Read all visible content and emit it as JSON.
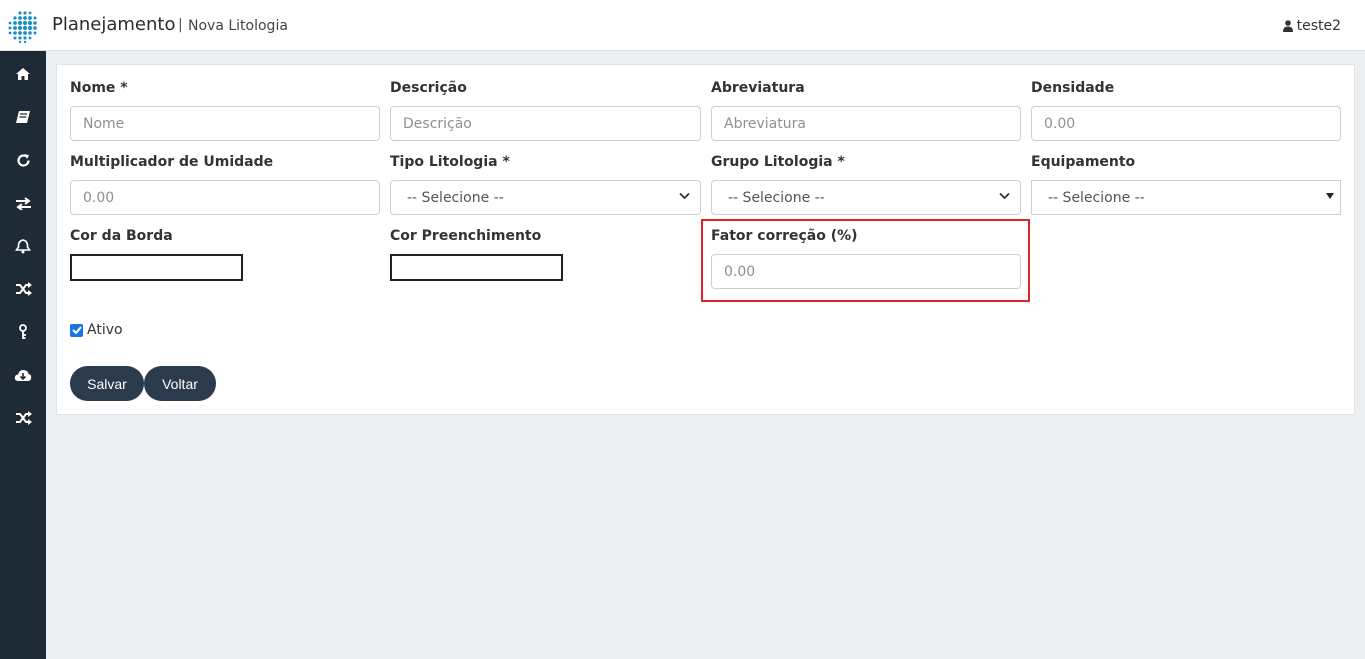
{
  "header": {
    "app_title": "Planejamento",
    "separator": "|",
    "page_title": "Nova Litologia",
    "user_name": "teste2"
  },
  "sidebar": {
    "icons": [
      "home-icon",
      "book-icon",
      "refresh-icon",
      "exchange-icon",
      "bell-icon",
      "shuffle-icon",
      "key-icon",
      "cloud-download-icon",
      "shuffle-icon"
    ]
  },
  "form": {
    "nome_label": "Nome *",
    "nome_placeholder": "Nome",
    "descricao_label": "Descrição",
    "descricao_placeholder": "Descrição",
    "abreviatura_label": "Abreviatura",
    "abreviatura_placeholder": "Abreviatura",
    "densidade_label": "Densidade",
    "densidade_placeholder": "0.00",
    "multiplicador_label": "Multiplicador de Umidade",
    "multiplicador_placeholder": "0.00",
    "tipo_label": "Tipo Litologia *",
    "tipo_value": "-- Selecione --",
    "grupo_label": "Grupo Litologia *",
    "grupo_value": "-- Selecione --",
    "equipamento_label": "Equipamento",
    "equipamento_value": "-- Selecione --",
    "cor_borda_label": "Cor da Borda",
    "cor_preenchimento_label": "Cor Preenchimento",
    "fator_label": "Fator correção (%)",
    "fator_placeholder": "0.00",
    "ativo_label": "Ativo",
    "ativo_checked": true
  },
  "actions": {
    "save_label": "Salvar",
    "back_label": "Voltar"
  },
  "colors": {
    "sidebar_bg": "#1f2a37",
    "button_bg": "#2b3a4c",
    "highlight": "#e02424",
    "logo": "#1a8fc4"
  }
}
